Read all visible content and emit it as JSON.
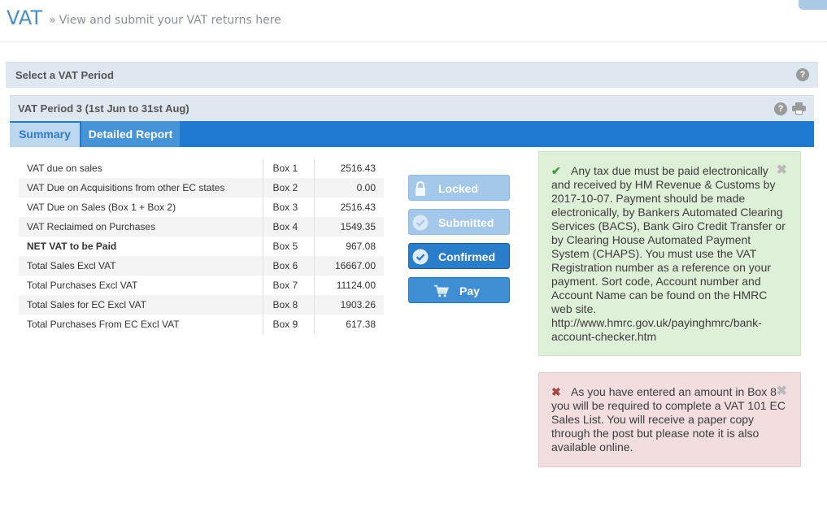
{
  "header": {
    "title": "VAT",
    "subtitle_chevron": "»",
    "subtitle": "View and submit your VAT returns here"
  },
  "period_select": {
    "label": "Select a VAT Period",
    "help_icon": "question-circle-icon"
  },
  "vat_period": {
    "title": "VAT Period 3 (1st Jun to 31st Aug)",
    "help_icon": "question-circle-icon",
    "print_icon": "print-icon"
  },
  "tabs": [
    {
      "label": "Summary",
      "active": true
    },
    {
      "label": "Detailed Report",
      "active": false
    }
  ],
  "summary_rows": [
    {
      "label": "VAT due on sales",
      "box": "Box 1",
      "value": "2516.43",
      "bold": false
    },
    {
      "label": "VAT Due on Acquisitions from other EC states",
      "box": "Box 2",
      "value": "0.00",
      "bold": false
    },
    {
      "label": "VAT Due on Sales (Box 1 + Box 2)",
      "box": "Box 3",
      "value": "2516.43",
      "bold": false
    },
    {
      "label": "VAT Reclaimed on Purchases",
      "box": "Box 4",
      "value": "1549.35",
      "bold": false
    },
    {
      "label": "NET VAT to be Paid",
      "box": "Box 5",
      "value": "967.08",
      "bold": true
    },
    {
      "label": "Total Sales Excl VAT",
      "box": "Box 6",
      "value": "16667.00",
      "bold": false
    },
    {
      "label": "Total Purchases Excl VAT",
      "box": "Box 7",
      "value": "11124.00",
      "bold": false
    },
    {
      "label": "Total Sales for EC Excl VAT",
      "box": "Box 8",
      "value": "1903.26",
      "bold": false
    },
    {
      "label": "Total Purchases From EC Excl VAT",
      "box": "Box 9",
      "value": "617.38",
      "bold": false
    }
  ],
  "status_buttons": {
    "locked": {
      "label": "Locked",
      "icon": "lock-icon"
    },
    "submitted": {
      "label": "Submitted",
      "icon": "check-circle-icon"
    },
    "confirmed": {
      "label": "Confirmed",
      "icon": "check-circle-icon"
    },
    "pay": {
      "label": "Pay",
      "icon": "shopping-cart-icon"
    }
  },
  "alerts": {
    "success": {
      "icon": "✔",
      "text": "Any tax due must be paid electronically and received by HM Revenue & Customs by 2017-10-07. Payment should be made electronically, by Bankers Automated Clearing Services (BACS), Bank Giro Credit Transfer or by Clearing House Automated Payment System (CHAPS). You must use the VAT Registration number as a reference on your payment. Sort code, Account number and Account Name can be found on the HMRC web site. http://www.hmrc.gov.uk/payinghmrc/bank-account-checker.htm",
      "close": "✖"
    },
    "danger": {
      "icon": "✖",
      "text": "As you have entered an amount in Box 8 you will be required to complete a VAT 101 EC Sales List. You will receive a paper copy through the post but please note it is also available online.",
      "close": "✖"
    }
  },
  "colors": {
    "accent_blue": "#1f7bcf",
    "title_blue": "#4a8bc9",
    "success_bg": "#dff0d8",
    "danger_bg": "#f2dede"
  }
}
